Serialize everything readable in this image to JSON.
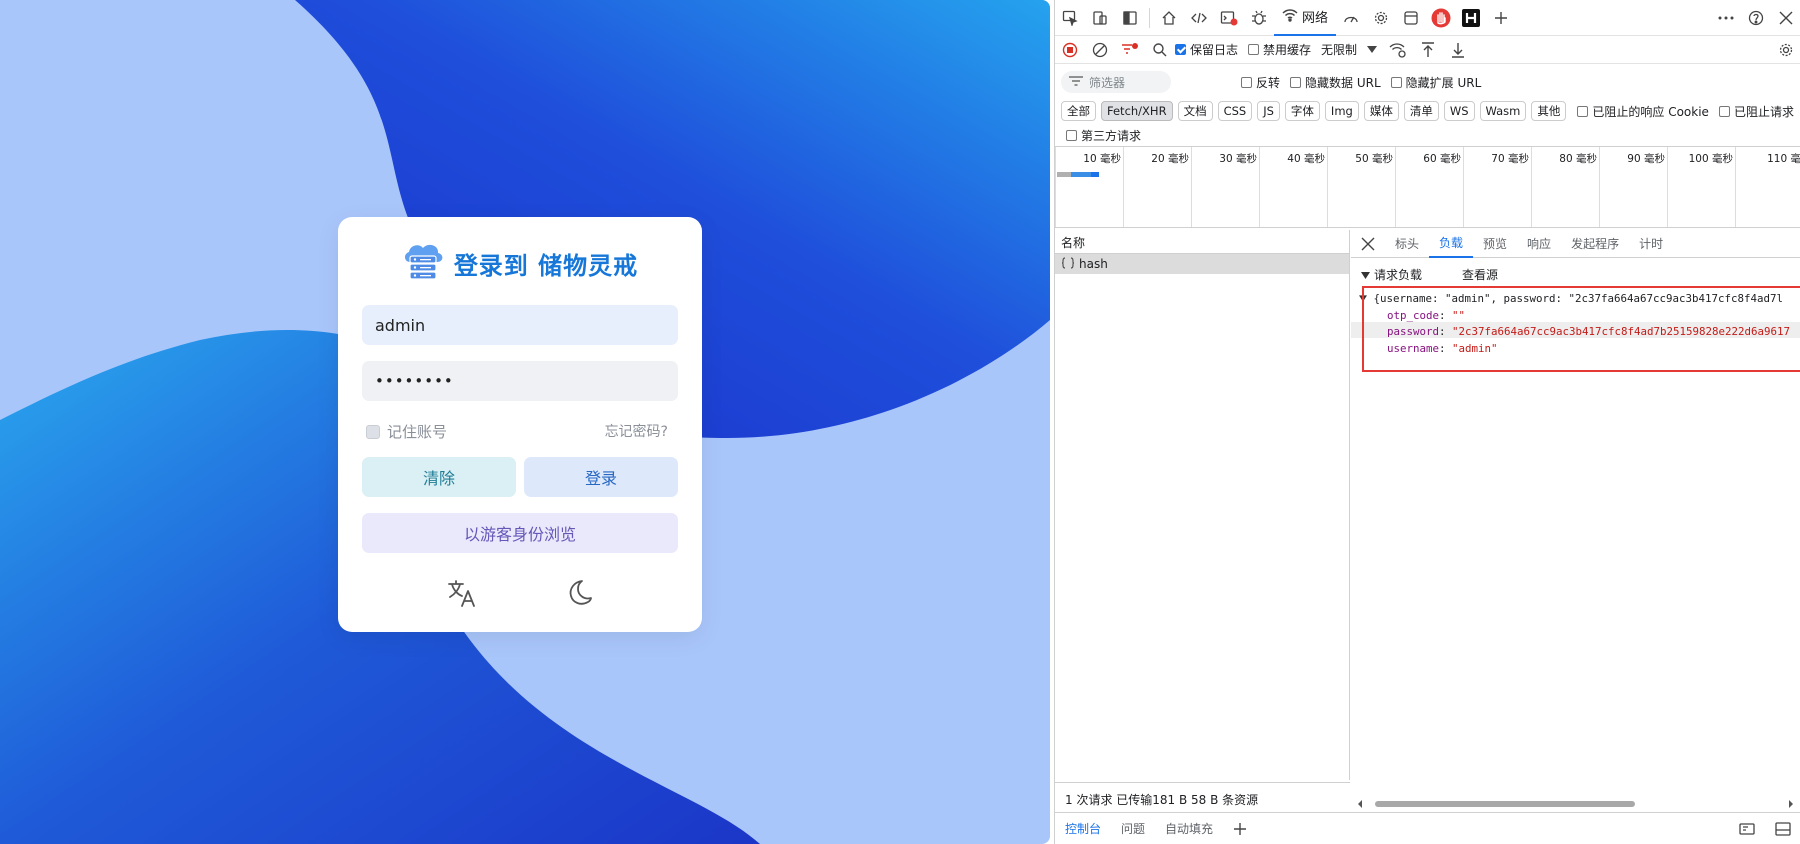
{
  "login": {
    "title": "登录到 储物灵戒",
    "username_value": "admin",
    "password_value": "••••••••",
    "remember_label": "记住账号",
    "forgot_label": "忘记密码?",
    "clear_label": "清除",
    "login_label": "登录",
    "guest_label": "以游客身份浏览",
    "icons": [
      "cloud-server-icon",
      "translate-icon",
      "moon-icon"
    ],
    "colors": {
      "title": "#1677d8",
      "bg_light": "#a9c6fb",
      "bg_dark": "#1f3fd1"
    }
  },
  "devtools": {
    "network_tab": "网络",
    "toolbar2": {
      "preserve_log": "保留日志",
      "disable_cache": "禁用缓存",
      "throttle": "无限制"
    },
    "filter": {
      "placeholder": "筛选器",
      "invert": "反转",
      "hide_data_url": "隐藏数据 URL",
      "hide_ext_url": "隐藏扩展 URL"
    },
    "types": [
      "全部",
      "Fetch/XHR",
      "文档",
      "CSS",
      "JS",
      "字体",
      "Img",
      "媒体",
      "清单",
      "WS",
      "Wasm",
      "其他"
    ],
    "blocked_cookies": "已阻止的响应 Cookie",
    "blocked_requests": "已阻止请求",
    "third_party": "第三方请求",
    "timeline_ticks": [
      "10 毫秒",
      "20 毫秒",
      "30 毫秒",
      "40 毫秒",
      "50 毫秒",
      "60 毫秒",
      "70 毫秒",
      "80 毫秒",
      "90 毫秒",
      "100 毫秒",
      "110 毫"
    ],
    "name_header": "名称",
    "request_name": "hash",
    "detail_tabs": [
      "标头",
      "负载",
      "预览",
      "响应",
      "发起程序",
      "计时"
    ],
    "payload_header": "请求负载",
    "view_source": "查看源",
    "payload": {
      "summary": "{username: \"admin\", password: \"2c37fa664a67cc9ac3b417cfc8f4ad7l",
      "otp_key": "otp_code",
      "otp_val": "\"\"",
      "password_key": "password",
      "password_val": "\"2c37fa664a67cc9ac3b417cfc8f4ad7b25159828e222d6a9617",
      "username_key": "username",
      "username_val": "\"admin\""
    },
    "status": "1 次请求  已传输181 B  58 B 条资源",
    "drawer": [
      "控制台",
      "问题",
      "自动填充"
    ]
  }
}
